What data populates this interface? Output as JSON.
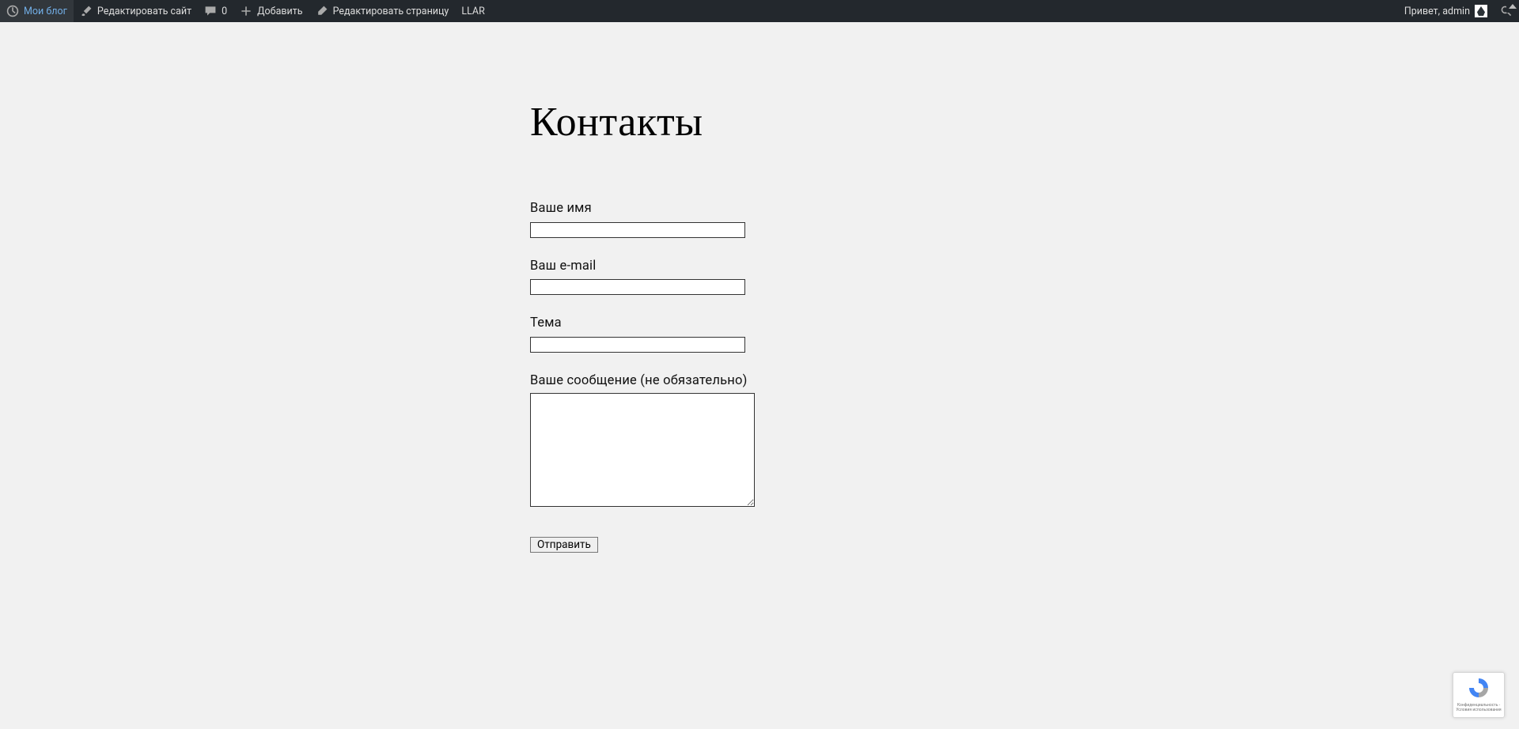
{
  "adminbar": {
    "site_name": "Мои блог",
    "customize": "Редактировать сайт",
    "comments_count": "0",
    "add_new": "Добавить",
    "edit_page": "Редактировать страницу",
    "llar": "LLAR",
    "greeting": "Привет, admin"
  },
  "page": {
    "title": "Контакты"
  },
  "form": {
    "name_label": "Ваше имя",
    "name_value": "",
    "email_label": "Ваш e-mail",
    "email_value": "",
    "subject_label": "Тема",
    "subject_value": "",
    "message_label": "Ваше сообщение (не обязательно)",
    "message_value": "",
    "submit_label": "Отправить"
  },
  "recaptcha": {
    "line1": "Конфиденциальность -",
    "line2": "Условия использования"
  }
}
